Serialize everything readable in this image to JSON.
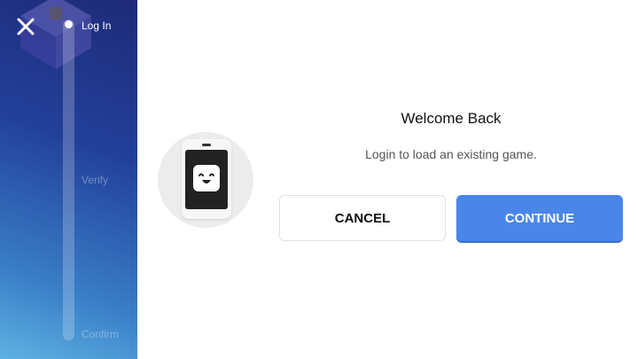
{
  "steps": [
    {
      "label": "Log In",
      "active": true
    },
    {
      "label": "Verify",
      "active": false
    },
    {
      "label": "Confirm",
      "active": false
    }
  ],
  "dialog": {
    "title": "Welcome Back",
    "subtitle": "Login to load an existing game."
  },
  "buttons": {
    "cancel_label": "CANCEL",
    "continue_label": "CONTINUE"
  },
  "icons": {
    "close": "close-icon",
    "illustration": "phone-face-icon",
    "background": "game-decoration"
  },
  "colors": {
    "sidebar_top": "#1e2a78",
    "sidebar_bottom": "#5fb2e3",
    "primary_button": "#4a86ea"
  }
}
